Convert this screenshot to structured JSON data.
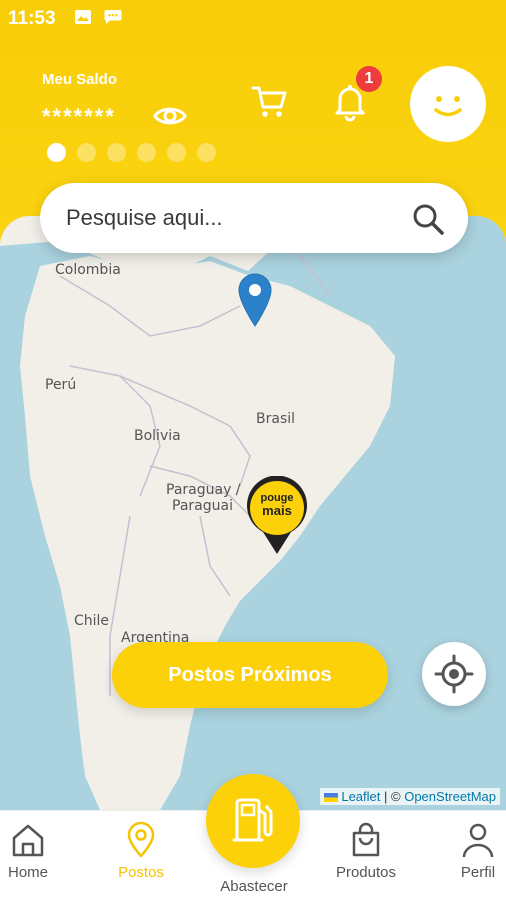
{
  "status_bar": {
    "time": "11:53",
    "icons": [
      "image-icon",
      "message-icon"
    ]
  },
  "header": {
    "balance_label": "Meu Saldo",
    "balance_value": "*******",
    "carousel_dots": 6,
    "active_dot": 0,
    "notification_count": "1",
    "accent_color": "#FCD10A"
  },
  "search": {
    "placeholder": "Pesquise aqui..."
  },
  "map": {
    "labels": {
      "colombia": "Colombia",
      "peru": "Perú",
      "brasil": "Brasil",
      "bolivia": "Bolivia",
      "paraguay": "Paraguay /",
      "paraguai": "Paraguai",
      "chile": "Chile",
      "argentina": "Argentina"
    },
    "brand_marker": {
      "line1": "pouge",
      "line2": "mais"
    },
    "attribution": {
      "leaflet": "Leaflet",
      "separator": "| ©",
      "osm": "OpenStreetMap"
    }
  },
  "actions": {
    "nearby_button": "Postos Próximos"
  },
  "bottom_nav": {
    "home": "Home",
    "postos": "Postos",
    "abastecer": "Abastecer",
    "produtos": "Produtos",
    "perfil": "Perfil"
  }
}
